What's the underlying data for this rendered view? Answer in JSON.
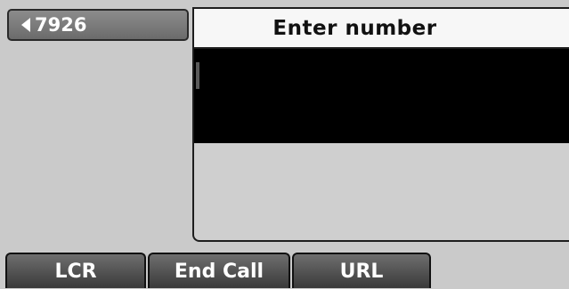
{
  "line_key": {
    "label": "7926",
    "icon": "left-arrow-icon"
  },
  "dialog": {
    "title": "Enter number",
    "entry_value": ""
  },
  "softkeys": [
    {
      "label": "LCR"
    },
    {
      "label": "End Call"
    },
    {
      "label": "URL"
    }
  ],
  "colors": {
    "screen_bg": "#cacaca",
    "title_bg": "#f7f7f7",
    "entry_bg": "#000000",
    "softkey_bg": "#4a4a4a",
    "text_light": "#ffffff"
  }
}
